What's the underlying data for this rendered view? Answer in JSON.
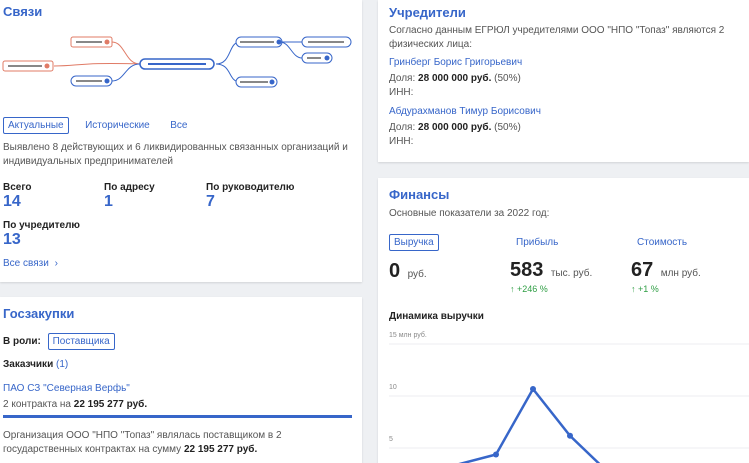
{
  "svyazi": {
    "title": "Связи",
    "tabs": [
      "Актуальные",
      "Исторические",
      "Все"
    ],
    "description": "Выявлено 8 действующих и 6 ликвидированных связанных организаций и индивидуальных предпринимателей",
    "stats": [
      {
        "label": "Всего",
        "value": "14"
      },
      {
        "label": "По адресу",
        "value": "1"
      },
      {
        "label": "По руководителю",
        "value": "7"
      },
      {
        "label": "По учредителю",
        "value": "13"
      }
    ],
    "all_link": "Все связи",
    "colors": {
      "accent": "#3766c9",
      "historic": "#e07b66"
    }
  },
  "goszakupki": {
    "title": "Госзакупки",
    "role_label": "В роли:",
    "role_value": "Поставщика",
    "customers_label": "Заказчики",
    "customers_count": "(1)",
    "customer_name": "ПАО СЗ \"Северная Верфь\"",
    "contracts_text": "2 контракта на",
    "contracts_sum": "22 195 277 руб.",
    "summary_pre": "Организация ООО \"НПО \"Топаз\" являлась поставщиком в 2 государственных контрактах на сумму",
    "summary_sum": "22 195 277 руб."
  },
  "uchrediteli": {
    "title": "Учредители",
    "intro": "Согласно данным ЕГРЮЛ учредителями ООО \"НПО \"Топаз\" являются 2 физических лица:",
    "share_label": "Доля:",
    "inn_label": "ИНН:",
    "founders": [
      {
        "name": "Гринберг Борис Григорьевич",
        "share": "28 000 000 руб.",
        "pct": "(50%)"
      },
      {
        "name": "Абдурахманов Тимур Борисович",
        "share": "28 000 000 руб.",
        "pct": "(50%)"
      }
    ]
  },
  "finansy": {
    "title": "Финансы",
    "subtitle": "Основные показатели за 2022 год:",
    "metrics": [
      {
        "label": "Выручка",
        "value": "0",
        "unit": "руб.",
        "change": ""
      },
      {
        "label": "Прибыль",
        "value": "583",
        "unit": "тыс. руб.",
        "change": "+246 %"
      },
      {
        "label": "Стоимость",
        "value": "67",
        "unit": "млн руб.",
        "change": "+1 %"
      }
    ],
    "chart_title": "Динамика выручки"
  },
  "chart_data": {
    "type": "line",
    "title": "Динамика выручки",
    "ylabel_unit": "млн руб.",
    "y_ticks": [
      "15 млн руб.",
      "10",
      "5"
    ],
    "ylim": [
      0,
      15
    ],
    "series": [
      {
        "values": [
          2.5,
          3.7,
          10,
          5.5,
          2
        ]
      }
    ],
    "color": "#3766c9"
  }
}
